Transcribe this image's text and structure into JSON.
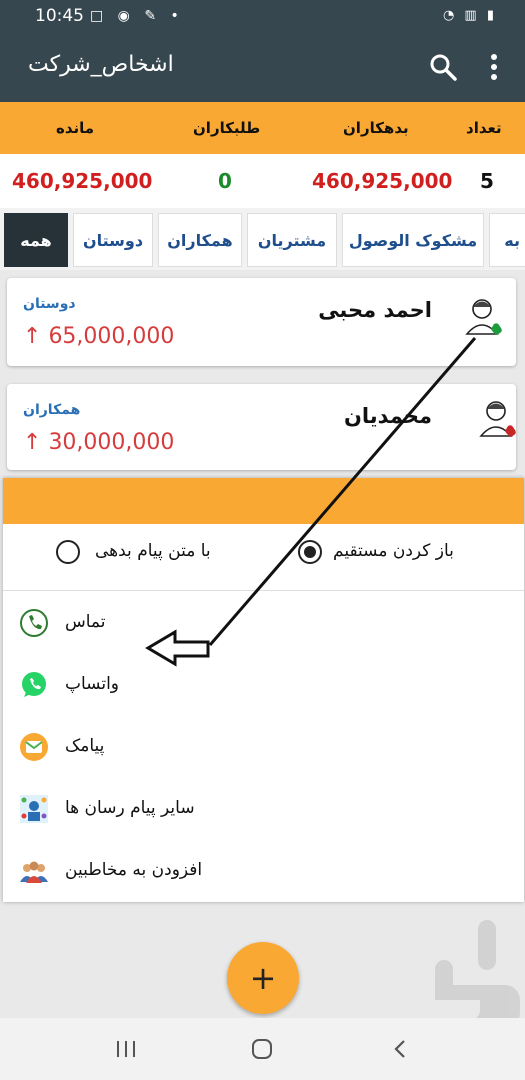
{
  "status_bar": {
    "time": "10:45",
    "left_icons": "□ ◉ ✎ •",
    "right_icons": "◔ ▥ ▮"
  },
  "app_bar": {
    "title": "اشخاص_شرکت",
    "search_icon": "search-icon",
    "more_icon": "more-vert-icon"
  },
  "summary": {
    "headers": {
      "count": "تعداد",
      "debtors": "بدهکاران",
      "creditors": "طلبکاران",
      "balance": "مانده"
    },
    "values": {
      "count": "5",
      "debtors": "460,925,000",
      "creditors": "0",
      "balance": "460,925,000"
    },
    "colors": {
      "debtors": "#d11f1f",
      "creditors": "#1b8a2a",
      "balance": "#d11f1f"
    }
  },
  "tabs": [
    "همه",
    "دوستان",
    "همکاران",
    "مشتریان",
    "مشکوک الوصول",
    "به"
  ],
  "active_tab": "همه",
  "contacts": [
    {
      "name": "احمد محبی",
      "group": "دوستان",
      "amount": "65,000,000",
      "arrow": "↑"
    },
    {
      "name": "محمدیان",
      "group": "همکاران",
      "amount": "30,000,000",
      "arrow": "↑"
    }
  ],
  "sheet": {
    "radio_direct": "باز کردن مستقیم",
    "radio_message": "با متن پیام بدهی",
    "selected": "direct",
    "options": [
      {
        "label": "تماس",
        "icon": "phone-icon"
      },
      {
        "label": "واتساپ",
        "icon": "whatsapp-icon"
      },
      {
        "label": "پیامک",
        "icon": "sms-icon"
      },
      {
        "label": "سایر پیام رسان ها",
        "icon": "messengers-icon"
      },
      {
        "label": "افزودن به مخاطبین",
        "icon": "add-contact-icon"
      }
    ]
  },
  "fab": {
    "label": "+"
  },
  "colors": {
    "appbar": "#37474f",
    "accent": "#f9a833",
    "link_blue": "#2a6fb5",
    "amount_red": "#d63c3c"
  }
}
